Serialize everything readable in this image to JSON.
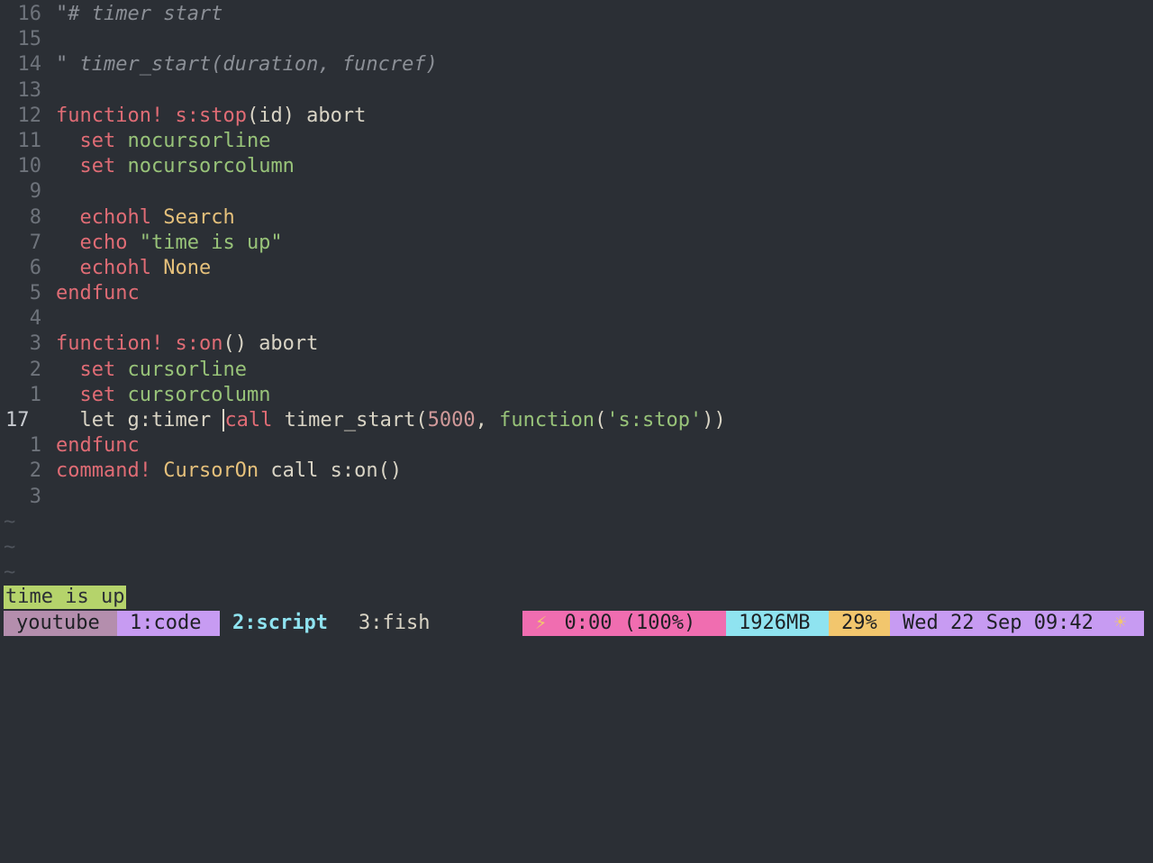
{
  "editor": {
    "lines": [
      {
        "num": "16",
        "tokens": [
          {
            "t": "\"# timer start",
            "c": "cmt"
          }
        ]
      },
      {
        "num": "15",
        "tokens": []
      },
      {
        "num": "14",
        "tokens": [
          {
            "t": "\" timer_start(duration, funcref)",
            "c": "cmt"
          }
        ]
      },
      {
        "num": "13",
        "tokens": []
      },
      {
        "num": "12",
        "tokens": [
          {
            "t": "function!",
            "c": "kw"
          },
          {
            "t": " ",
            "c": "plain"
          },
          {
            "t": "s:stop",
            "c": "fn"
          },
          {
            "t": "(id) abort",
            "c": "plain"
          }
        ]
      },
      {
        "num": "11",
        "tokens": [
          {
            "t": "  ",
            "c": "plain"
          },
          {
            "t": "set",
            "c": "kw"
          },
          {
            "t": " ",
            "c": "plain"
          },
          {
            "t": "nocursorline",
            "c": "opt"
          }
        ]
      },
      {
        "num": "10",
        "tokens": [
          {
            "t": "  ",
            "c": "plain"
          },
          {
            "t": "set",
            "c": "kw"
          },
          {
            "t": " ",
            "c": "plain"
          },
          {
            "t": "nocursorcolumn",
            "c": "opt"
          }
        ]
      },
      {
        "num": "9",
        "tokens": []
      },
      {
        "num": "8",
        "tokens": [
          {
            "t": "  ",
            "c": "plain"
          },
          {
            "t": "echohl",
            "c": "kw"
          },
          {
            "t": " ",
            "c": "plain"
          },
          {
            "t": "Search",
            "c": "hl"
          }
        ]
      },
      {
        "num": "7",
        "tokens": [
          {
            "t": "  ",
            "c": "plain"
          },
          {
            "t": "echo",
            "c": "kw"
          },
          {
            "t": " ",
            "c": "plain"
          },
          {
            "t": "\"time is up\"",
            "c": "str"
          }
        ]
      },
      {
        "num": "6",
        "tokens": [
          {
            "t": "  ",
            "c": "plain"
          },
          {
            "t": "echohl",
            "c": "kw"
          },
          {
            "t": " ",
            "c": "plain"
          },
          {
            "t": "None",
            "c": "hl"
          }
        ]
      },
      {
        "num": "5",
        "tokens": [
          {
            "t": "endfunc",
            "c": "kw"
          }
        ]
      },
      {
        "num": "4",
        "tokens": []
      },
      {
        "num": "3",
        "tokens": [
          {
            "t": "function!",
            "c": "kw"
          },
          {
            "t": " ",
            "c": "plain"
          },
          {
            "t": "s:on",
            "c": "fn"
          },
          {
            "t": "() abort",
            "c": "plain"
          }
        ]
      },
      {
        "num": "2",
        "tokens": [
          {
            "t": "  ",
            "c": "plain"
          },
          {
            "t": "set",
            "c": "kw"
          },
          {
            "t": " ",
            "c": "plain"
          },
          {
            "t": "cursorline",
            "c": "opt"
          }
        ]
      },
      {
        "num": "1",
        "tokens": [
          {
            "t": "  ",
            "c": "plain"
          },
          {
            "t": "set",
            "c": "kw"
          },
          {
            "t": " ",
            "c": "plain"
          },
          {
            "t": "cursorcolumn",
            "c": "opt"
          }
        ]
      },
      {
        "num": "17",
        "current": true,
        "tokens": [
          {
            "t": "  let g:timer ",
            "c": "plain"
          },
          {
            "t": "call",
            "c": "kw",
            "cursor": true
          },
          {
            "t": " timer_start(",
            "c": "plain"
          },
          {
            "t": "5000",
            "c": "num"
          },
          {
            "t": ", ",
            "c": "plain"
          },
          {
            "t": "function",
            "c": "opt"
          },
          {
            "t": "(",
            "c": "plain"
          },
          {
            "t": "'s:stop'",
            "c": "str"
          },
          {
            "t": "))",
            "c": "plain"
          }
        ]
      },
      {
        "num": "1",
        "tokens": [
          {
            "t": "endfunc",
            "c": "kw"
          }
        ]
      },
      {
        "num": "2",
        "tokens": [
          {
            "t": "command!",
            "c": "kw"
          },
          {
            "t": " CursorOn ",
            "c": "hl"
          },
          {
            "t": "call s:on()",
            "c": "plain"
          }
        ]
      },
      {
        "num": "3",
        "tokens": []
      }
    ],
    "tildes": [
      "~",
      "~",
      "~"
    ]
  },
  "message": "time is up",
  "statusbar": {
    "session": "youtube",
    "tabs": [
      "1:code",
      "2:script",
      "3:fish"
    ],
    "battery_icon": "lightning-icon",
    "battery": "0:00 (100%)",
    "bolt": "⚡",
    "memory": "1926MB",
    "cpu": "29%",
    "datetime": "Wed 22 Sep 09:42",
    "weather_icon": "☀"
  }
}
